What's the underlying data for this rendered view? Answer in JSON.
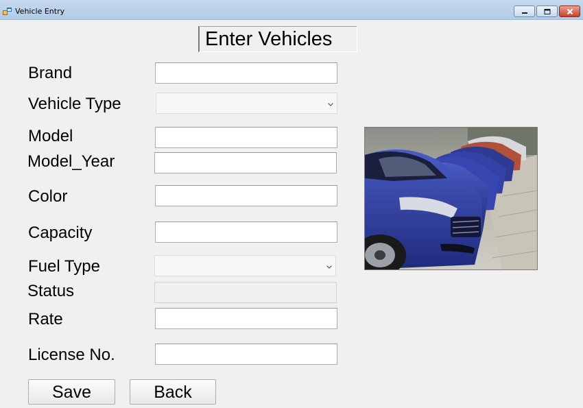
{
  "window": {
    "title": "Vehicle Entry",
    "controls": {
      "minimize": "minimize",
      "maximize": "maximize",
      "close": "close"
    }
  },
  "form": {
    "heading": "Enter Vehicles",
    "fields": {
      "brand": {
        "label": "Brand",
        "value": ""
      },
      "vehicle_type": {
        "label": "Vehicle Type",
        "value": ""
      },
      "model": {
        "label": "Model",
        "value": ""
      },
      "model_year": {
        "label": "Model_Year",
        "value": ""
      },
      "color": {
        "label": "Color",
        "value": ""
      },
      "capacity": {
        "label": "Capacity",
        "value": ""
      },
      "fuel_type": {
        "label": "Fuel Type",
        "value": ""
      },
      "status": {
        "label": "Status",
        "value": ""
      },
      "rate": {
        "label": "Rate",
        "value": ""
      },
      "license_no": {
        "label": "License No.",
        "value": ""
      }
    }
  },
  "buttons": {
    "save": "Save",
    "back": "Back"
  },
  "colors": {
    "car_body": "#2b3c9c",
    "titlebar": "#bcd3ea",
    "close_button": "#c6432c"
  },
  "icons": [
    "app-icon",
    "minimize-icon",
    "maximize-icon",
    "close-icon",
    "chevron-down-icon"
  ]
}
